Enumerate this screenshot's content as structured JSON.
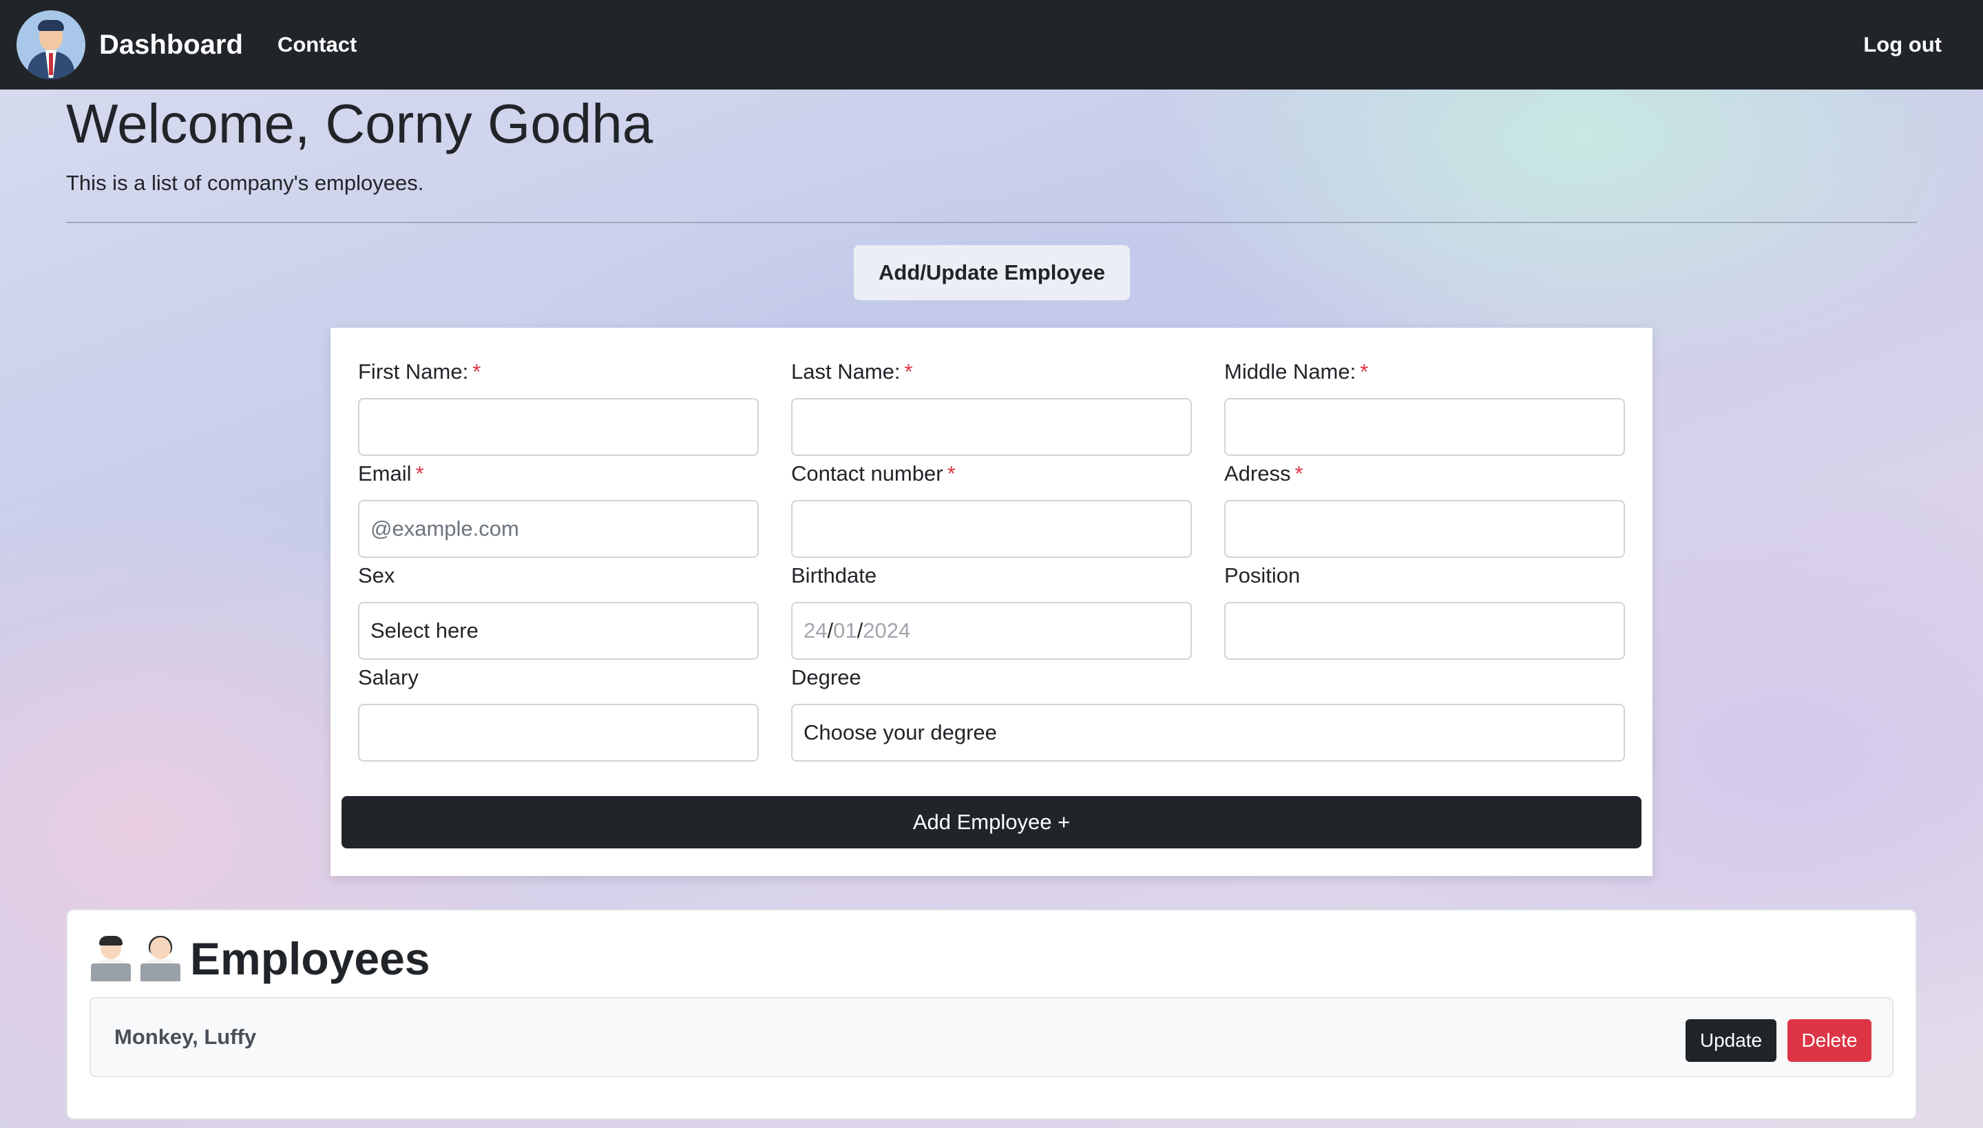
{
  "navbar": {
    "brand": "Dashboard",
    "contact": "Contact",
    "logout": "Log out"
  },
  "header": {
    "welcome": "Welcome, Corny Godha",
    "subtitle": "This is a list of company's employees."
  },
  "toggle_button": "Add/Update Employee",
  "form": {
    "required_mark": "*",
    "first_name": {
      "label": "First Name:",
      "value": ""
    },
    "last_name": {
      "label": "Last Name:",
      "value": ""
    },
    "middle_name": {
      "label": "Middle Name:",
      "value": ""
    },
    "email": {
      "label": "Email",
      "placeholder": "@example.com",
      "value": ""
    },
    "contact_number": {
      "label": "Contact number",
      "value": ""
    },
    "address": {
      "label": "Adress",
      "value": ""
    },
    "sex": {
      "label": "Sex",
      "selected": "Select here"
    },
    "birthdate": {
      "label": "Birthdate",
      "day": "24",
      "month": "01",
      "year": "2024",
      "separator": "/"
    },
    "position": {
      "label": "Position",
      "value": ""
    },
    "salary": {
      "label": "Salary",
      "value": ""
    },
    "degree": {
      "label": "Degree",
      "selected": "Choose your degree"
    },
    "submit": "Add Employee +"
  },
  "employees": {
    "heading": "Employees",
    "icons": [
      "man-technologist-icon",
      "woman-technologist-icon"
    ],
    "rows": [
      {
        "name": "Monkey, Luffy",
        "update": "Update",
        "delete": "Delete"
      }
    ]
  },
  "colors": {
    "navbar": "#212529",
    "required": "#dc3545",
    "delete": "#dc3545",
    "update": "#212529"
  }
}
